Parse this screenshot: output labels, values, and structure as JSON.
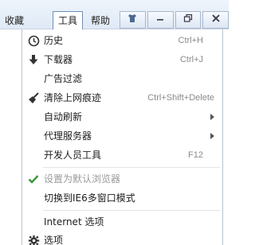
{
  "menubar": {
    "items": [
      {
        "label": "收藏"
      },
      {
        "label": "工具"
      },
      {
        "label": "帮助"
      }
    ],
    "buttons": {
      "skin": "⚙",
      "minimize": "—",
      "restore": "🗗",
      "close": "✕"
    }
  },
  "menu": {
    "items": [
      {
        "label": "历史",
        "shortcut": "Ctrl+H",
        "icon": "clock-icon"
      },
      {
        "label": "下载器",
        "shortcut": "Ctrl+J",
        "icon": "download-arrow-icon"
      },
      {
        "label": "广告过滤",
        "shortcut": "",
        "icon": ""
      },
      {
        "label": "清除上网痕迹",
        "shortcut": "Ctrl+Shift+Delete",
        "icon": "broom-icon"
      },
      {
        "label": "自动刷新",
        "shortcut": "",
        "submenu": true
      },
      {
        "label": "代理服务器",
        "shortcut": "",
        "submenu": true
      },
      {
        "label": "开发人员工具",
        "shortcut": "F12"
      },
      {
        "label": "设置为默认浏览器",
        "disabled": true,
        "icon": "checkmark-icon"
      },
      {
        "label": "切换到IE6多窗口模式"
      },
      {
        "label": "Internet 选项"
      },
      {
        "label": "选项",
        "icon": "gear-icon"
      }
    ]
  },
  "colors": {
    "checkmark": "#3a9a3a",
    "menubar_bg": "#e4edf8",
    "disabled_text": "#9a9a9a"
  }
}
